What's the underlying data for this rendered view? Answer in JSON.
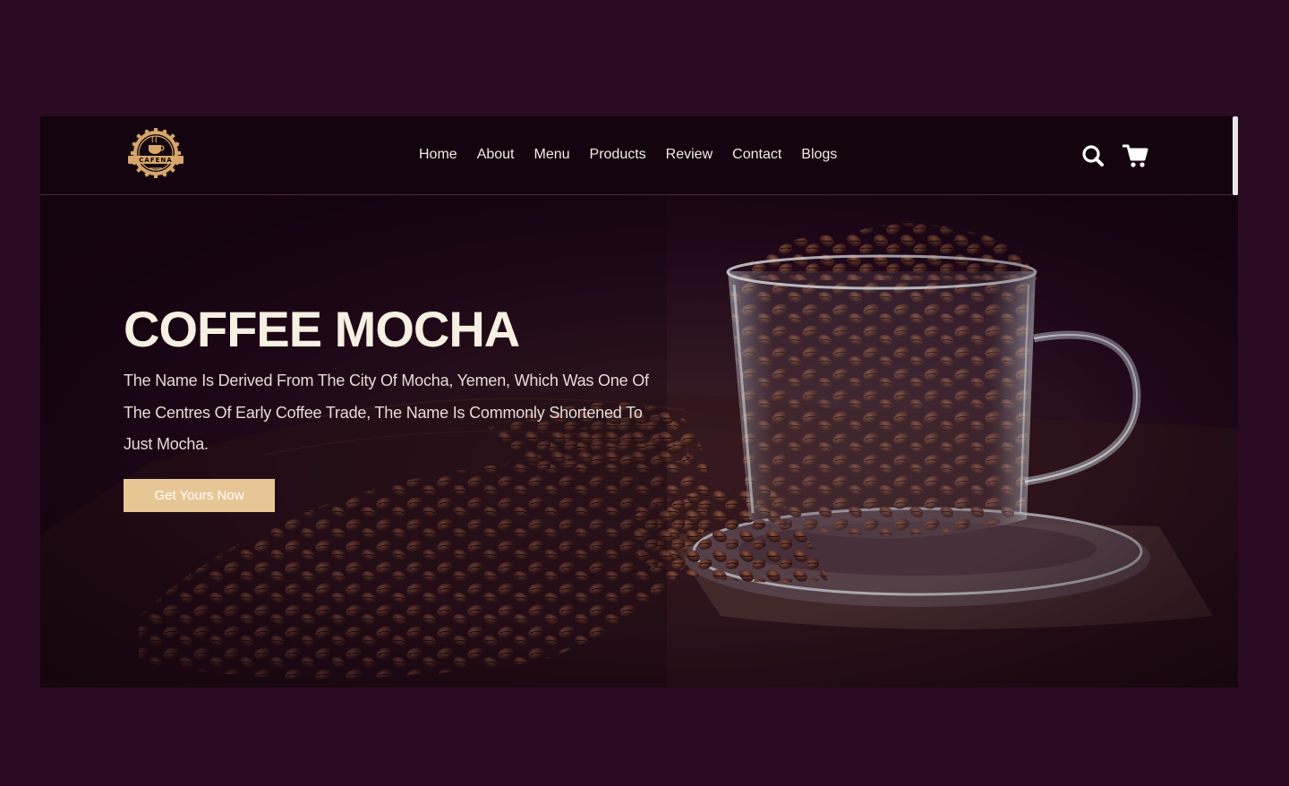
{
  "brand": {
    "logo_text": "CAFENA"
  },
  "nav": {
    "items": [
      {
        "label": "Home"
      },
      {
        "label": "About"
      },
      {
        "label": "Menu"
      },
      {
        "label": "Products"
      },
      {
        "label": "Review"
      },
      {
        "label": "Contact"
      },
      {
        "label": "Blogs"
      }
    ]
  },
  "header_icons": {
    "search": "search-icon",
    "cart": "cart-icon"
  },
  "hero": {
    "title": "COFFEE MOCHA",
    "description": "The Name Is Derived From The City Of Mocha, Yemen, Which Was One Of The Centres Of Early Coffee Trade, The Name Is Commonly Shortened To Just Mocha.",
    "cta_label": "Get Yours Now"
  },
  "colors": {
    "page_bg": "#2b0b22",
    "header_bg": "#14040f",
    "accent": "#e7c696",
    "text_light": "#f6f0e2"
  }
}
